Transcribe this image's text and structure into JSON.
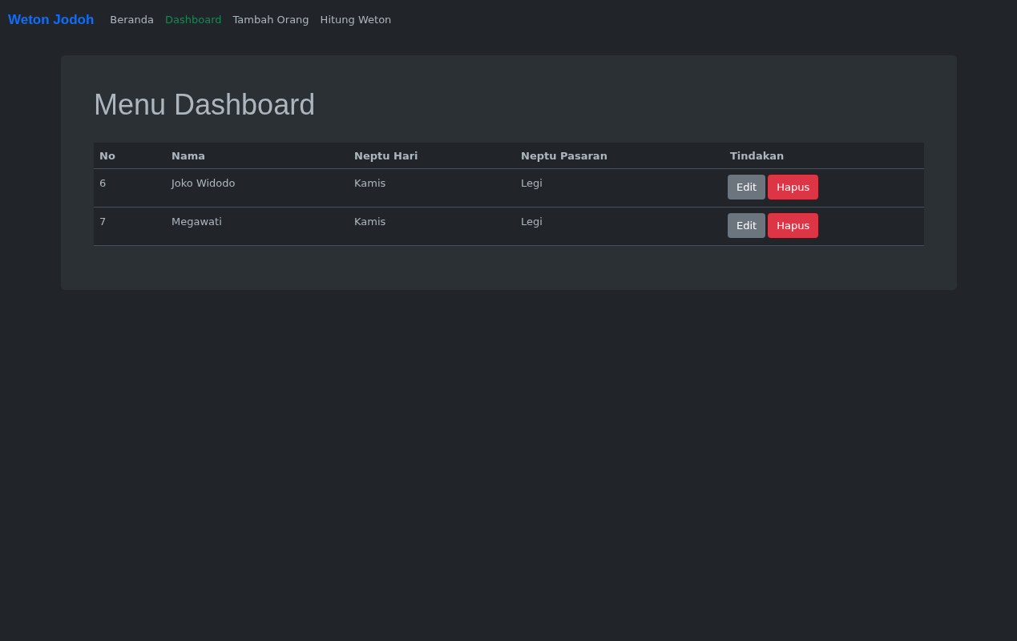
{
  "navbar": {
    "brand": "Weton Jodoh",
    "items": [
      {
        "label": "Beranda",
        "selected": false
      },
      {
        "label": "Dashboard",
        "selected": true
      },
      {
        "label": "Tambah Orang",
        "selected": false
      },
      {
        "label": "Hitung Weton",
        "selected": false
      }
    ]
  },
  "heading": "Menu Dashboard",
  "table": {
    "columns": [
      "No",
      "Nama",
      "Neptu Hari",
      "Neptu Pasaran",
      "Tindakan"
    ],
    "rows": [
      {
        "cells": [
          "6",
          "Joko Widodo",
          "Kamis",
          "Legi"
        ],
        "actions": [
          {
            "label": "Edit",
            "kind": "secondary"
          },
          {
            "label": "Hapus",
            "kind": "danger"
          }
        ]
      },
      {
        "cells": [
          "7",
          "Megawati",
          "Kamis",
          "Legi"
        ],
        "actions": [
          {
            "label": "Edit",
            "kind": "secondary"
          },
          {
            "label": "Hapus",
            "kind": "danger"
          }
        ]
      }
    ]
  }
}
